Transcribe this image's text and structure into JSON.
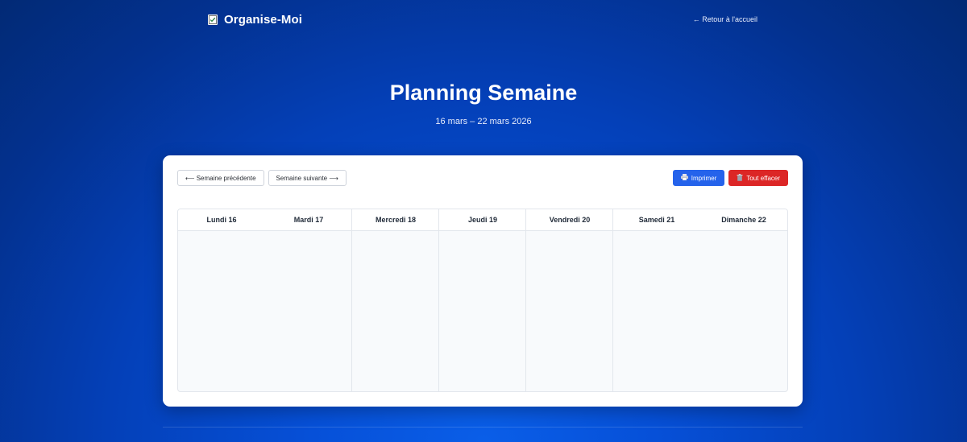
{
  "header": {
    "brand": "Organise-Moi",
    "back_link": "← Retour à l'accueil"
  },
  "hero": {
    "title": "Planning Semaine",
    "date_range": "16 mars – 22 mars 2026"
  },
  "toolbar": {
    "prev_week": "⟵ Semaine précédente",
    "next_week": "Semaine suivante ⟶",
    "print": "Imprimer",
    "clear_all": "Tout effacer"
  },
  "calendar": {
    "days": [
      {
        "label": "Lundi 16"
      },
      {
        "label": "Mardi 17"
      },
      {
        "label": "Mercredi 18"
      },
      {
        "label": "Jeudi 19"
      },
      {
        "label": "Vendredi 20"
      },
      {
        "label": "Samedi 21"
      },
      {
        "label": "Dimanche 22"
      }
    ]
  },
  "icons": {
    "brand": "checklist-icon",
    "print": "printer-icon",
    "clear": "trash-icon"
  },
  "colors": {
    "primary": "#2563eb",
    "danger": "#dc2626",
    "background": "#0440b8"
  }
}
